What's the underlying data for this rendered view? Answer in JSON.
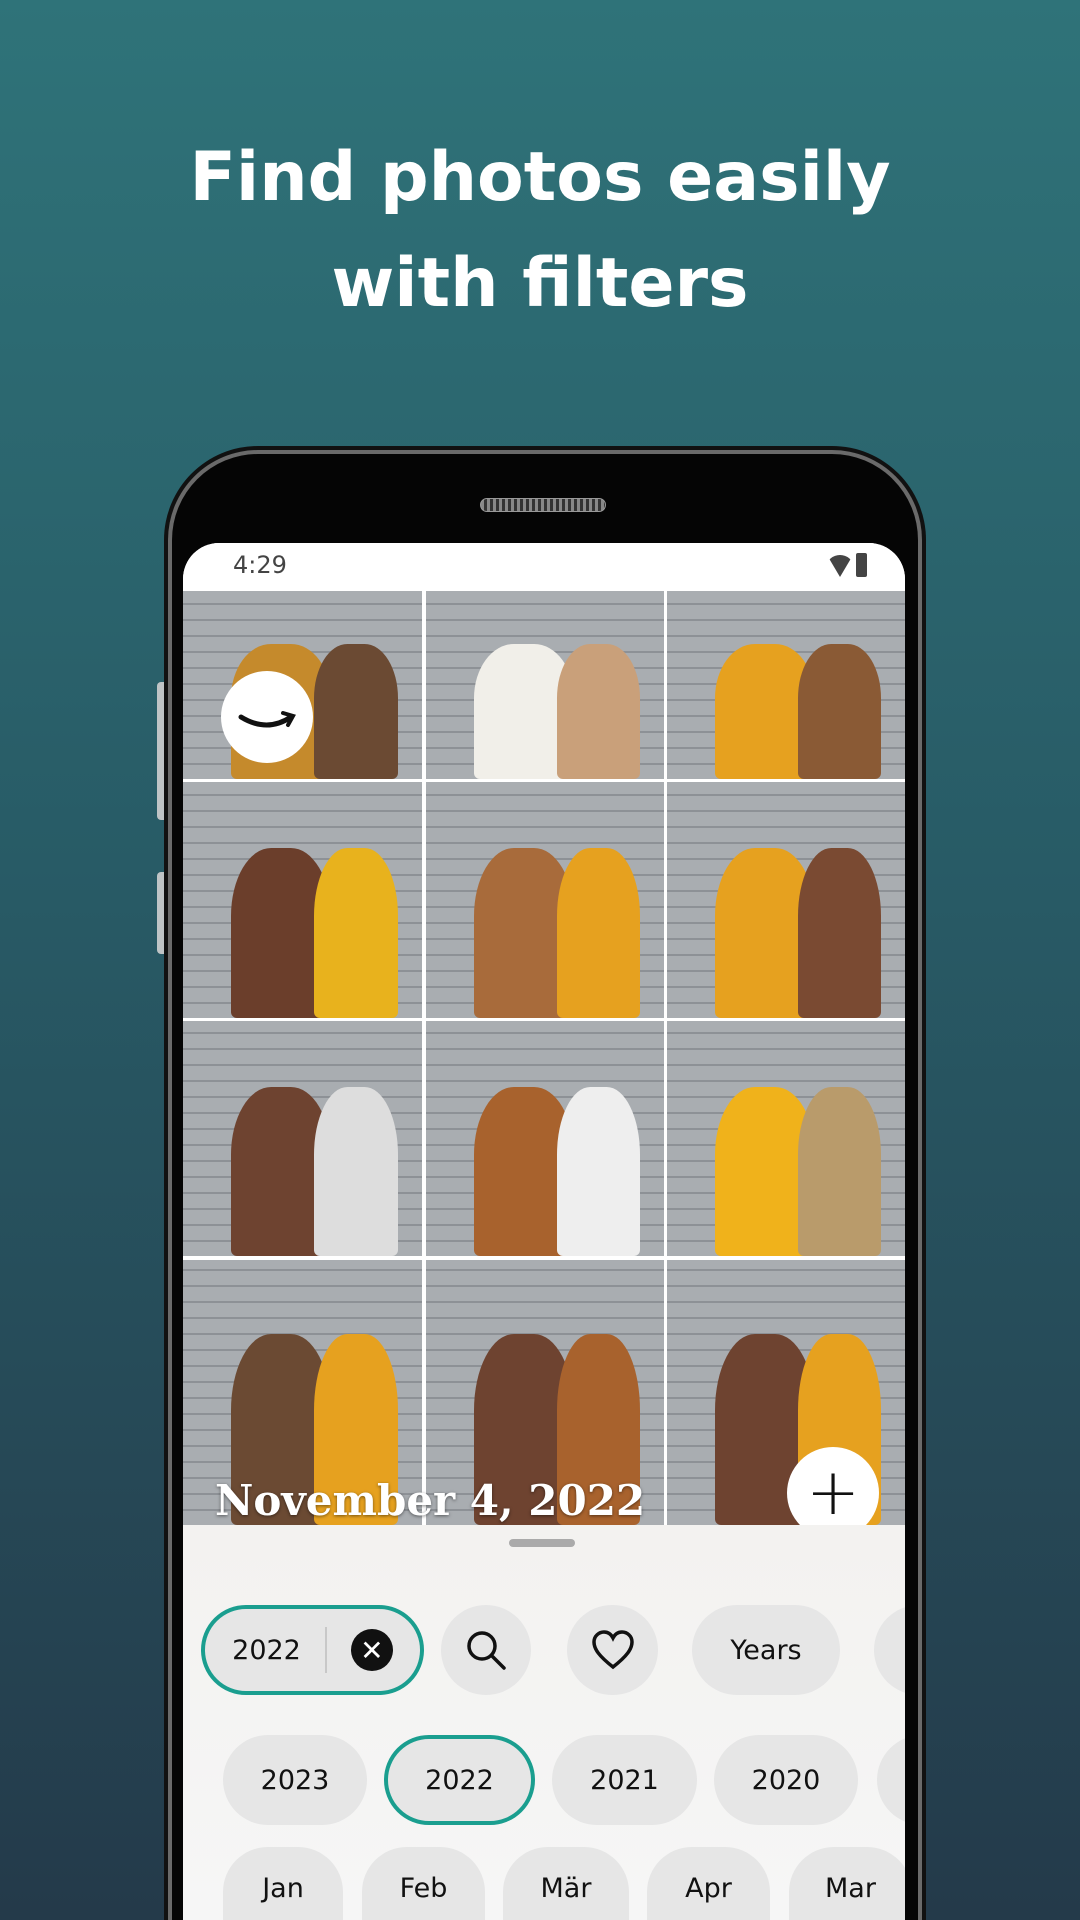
{
  "headline": {
    "line1": "Find photos easily",
    "line2": "with filters"
  },
  "status_bar": {
    "time": "4:29",
    "icons": [
      "wifi-icon",
      "battery-icon"
    ]
  },
  "gallery": {
    "logo": "amazon-smile-logo",
    "date_label": "November 4, 2022",
    "add_button_icon": "plus-icon"
  },
  "filters": {
    "active_filter": {
      "label": "2022",
      "clear_icon": "close-circle-icon"
    },
    "actions": [
      {
        "icon": "search-icon"
      },
      {
        "icon": "heart-icon"
      },
      {
        "label": "Years"
      }
    ],
    "years": [
      "2023",
      "2022",
      "2021",
      "2020"
    ],
    "selected_year": "2022",
    "months": [
      "Jan",
      "Feb",
      "Mär",
      "Apr",
      "Mar"
    ]
  },
  "colors": {
    "accent": "#1a9e8f",
    "background_top": "#2f7379",
    "background_bottom": "#243a4a"
  }
}
